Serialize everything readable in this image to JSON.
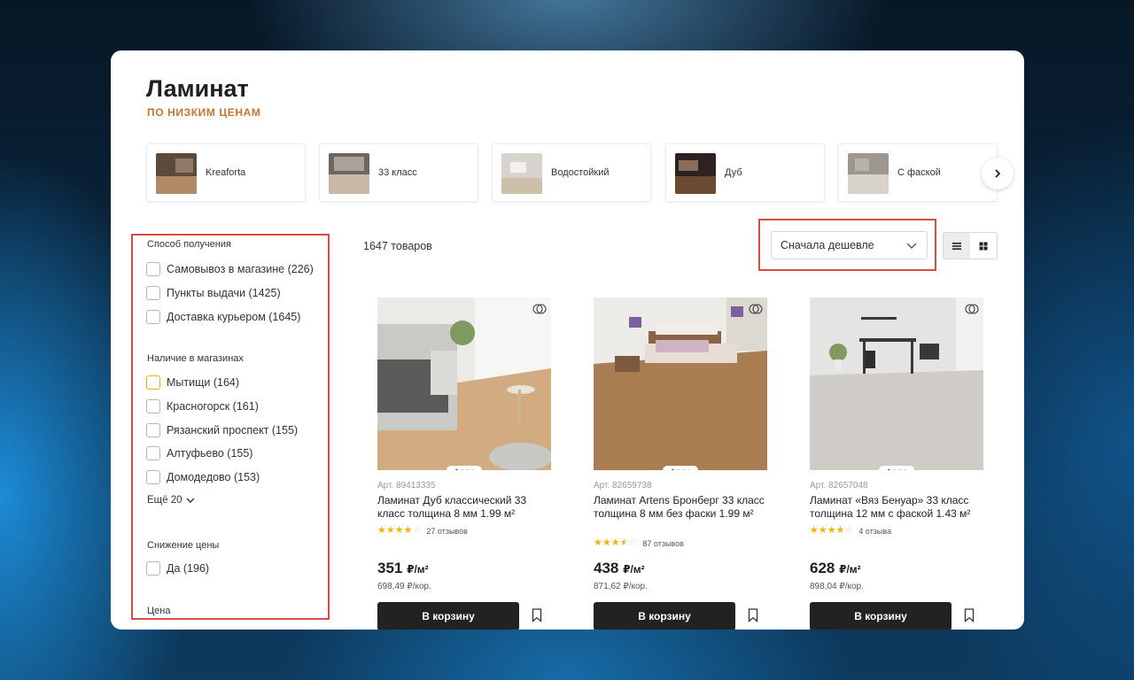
{
  "header": {
    "title": "Ламинат",
    "subtitle": "по низким ценам"
  },
  "categories": [
    {
      "label": "Kreaforta"
    },
    {
      "label": "33 класс"
    },
    {
      "label": "Водостойкий"
    },
    {
      "label": "Дуб"
    },
    {
      "label": "С фаской"
    }
  ],
  "filters": {
    "delivery": {
      "title": "Способ получения",
      "options": [
        {
          "label": "Самовывоз в магазине (226)",
          "checked": false
        },
        {
          "label": "Пункты выдачи (1425)",
          "checked": false
        },
        {
          "label": "Доставка курьером (1645)",
          "checked": false
        }
      ]
    },
    "stores": {
      "title": "Наличие в магазинах",
      "options": [
        {
          "label": "Мытищи (164)",
          "checked": false
        },
        {
          "label": "Красногорск (161)",
          "checked": false
        },
        {
          "label": "Рязанский проспект (155)",
          "checked": false
        },
        {
          "label": "Алтуфьево (155)",
          "checked": false
        },
        {
          "label": "Домодедово (153)",
          "checked": false
        }
      ],
      "more_label": "Ещё 20"
    },
    "discount": {
      "title": "Снижение цены",
      "options": [
        {
          "label": "Да (196)",
          "checked": false
        }
      ]
    },
    "price": {
      "title": "Цена"
    }
  },
  "toolbar": {
    "count": "1647 товаров",
    "sort_value": "Сначала дешевле"
  },
  "products": [
    {
      "article": "Арт. 89413335",
      "name": "Ламинат Дуб классический 33 класс толщина 8 мм 1.99 м²",
      "rating": 4,
      "reviews": "27 отзывов",
      "price": "351",
      "price_unit": "₽/м²",
      "price_per_box": "698,49 ₽/кор.",
      "cart_label": "В корзину"
    },
    {
      "article": "Арт. 82659738",
      "name": "Ламинат Artens Бронберг 33 класс толщина 8 мм без фаски 1.99 м²",
      "rating": 3.5,
      "reviews": "87 отзывов",
      "price": "438",
      "price_unit": "₽/м²",
      "price_per_box": "871,62 ₽/кор.",
      "cart_label": "В корзину"
    },
    {
      "article": "Арт. 82657048",
      "name": "Ламинат «Вяз Бенуар» 33 класс толщина 12 мм с фаской 1.43 м²",
      "rating": 4,
      "reviews": "4 отзыва",
      "price": "628",
      "price_unit": "₽/м²",
      "price_per_box": "898,04 ₽/кор.",
      "cart_label": "В корзину"
    }
  ],
  "colors": {
    "accent": "#c4752e",
    "highlight_border": "#d94b43",
    "button_bg": "#222222",
    "star": "#f0b400"
  }
}
